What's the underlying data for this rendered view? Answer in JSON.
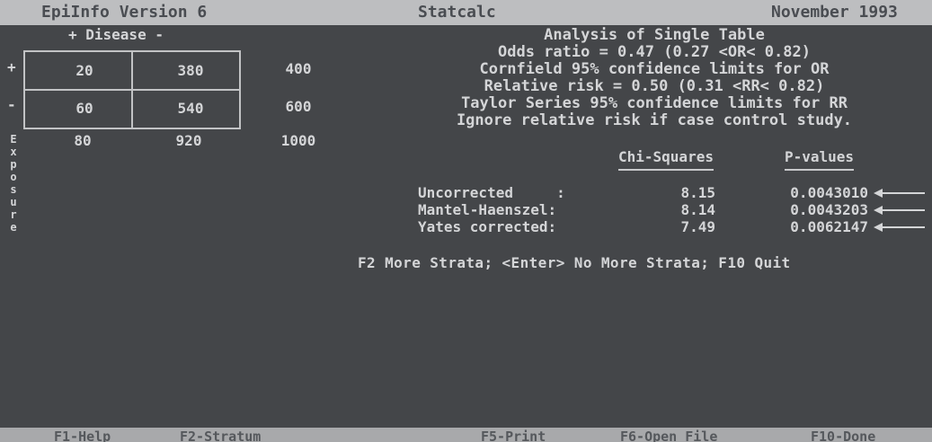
{
  "header": {
    "program": "EpiInfo Version 6",
    "module": "Statcalc",
    "date": "November 1993"
  },
  "table": {
    "disease_header": "+ Disease -",
    "exposure_label": "Exposure",
    "row_plus": "+",
    "row_minus": "-",
    "rows": [
      {
        "a": "20",
        "b": "380",
        "total": "400"
      },
      {
        "a": "60",
        "b": "540",
        "total": "600"
      }
    ],
    "col_totals": {
      "a": "80",
      "b": "920",
      "grand": "1000"
    }
  },
  "analysis": {
    "title": "Analysis of Single Table",
    "lines": [
      "Odds ratio = 0.47 (0.27 <OR< 0.82)",
      "Cornfield 95% confidence limits for OR",
      "Relative risk = 0.50 (0.31 <RR< 0.82)",
      "Taylor Series 95% confidence limits for RR",
      "Ignore relative risk if case control study."
    ]
  },
  "stats": {
    "col_chi": "Chi-Squares",
    "col_p": "P-values",
    "rows": [
      {
        "label": "Uncorrected     :",
        "chi": "8.15",
        "p": "0.0043010"
      },
      {
        "label": "Mantel-Haenszel:",
        "chi": "8.14",
        "p": "0.0043203"
      },
      {
        "label": "Yates corrected:",
        "chi": "7.49",
        "p": "0.0062147"
      }
    ]
  },
  "prompt": "F2 More Strata; <Enter> No More Strata; F10 Quit",
  "function_keys": {
    "f1": "F1-Help",
    "f2": "F2-Stratum",
    "f5": "F5-Print",
    "f6": "F6-Open File",
    "f10": "F10-Done"
  }
}
